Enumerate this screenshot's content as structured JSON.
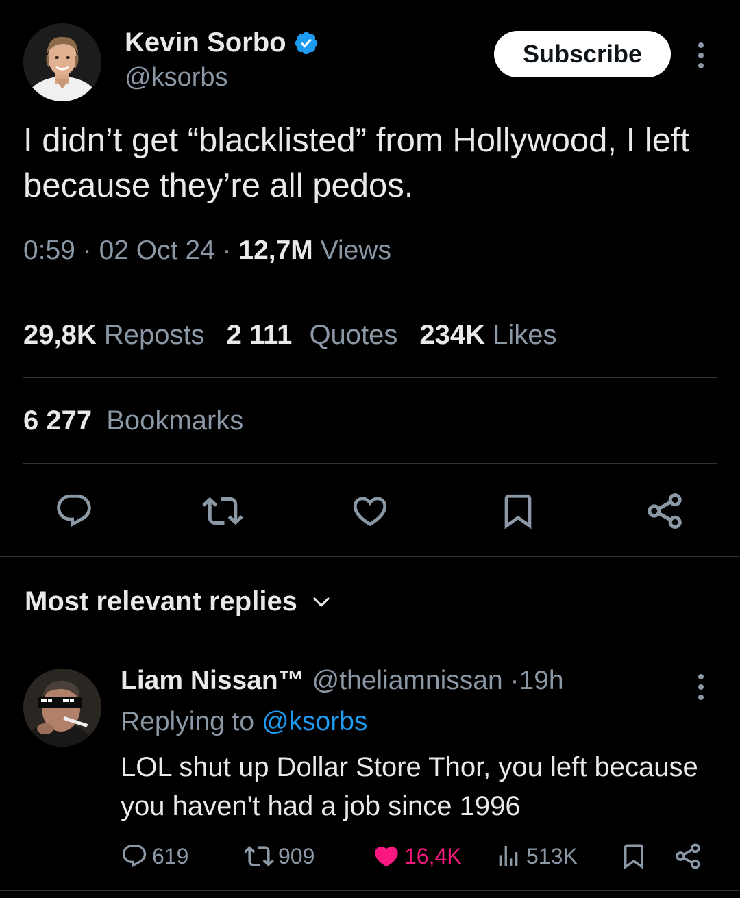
{
  "tweet": {
    "author_name": "Kevin Sorbo",
    "author_handle": "@ksorbs",
    "subscribe_label": "Subscribe",
    "text": "I didn’t get “blacklisted” from Hollywood, I left because they’re all pedos.",
    "time": "0:59",
    "separator": "·",
    "date": "02 Oct 24",
    "views_count": "12,7M",
    "views_label": "Views",
    "reposts_count": "29,8K",
    "reposts_label": "Reposts",
    "quotes_count": "2 111",
    "quotes_label": "Quotes",
    "likes_count": "234K",
    "likes_label": "Likes",
    "bookmarks_count": "6 277",
    "bookmarks_label": "Bookmarks"
  },
  "actions": {
    "icons": [
      "reply-icon",
      "repost-icon",
      "like-icon",
      "bookmark-icon",
      "share-icon"
    ]
  },
  "replies_header": {
    "label": "Most relevant replies"
  },
  "reply": {
    "author_name": "Liam Nissan™",
    "author_handle": "@theliamnissan",
    "separator": "·",
    "time": "19h",
    "replying_prefix": "Replying to",
    "replying_handle": "@ksorbs",
    "text": "LOL shut up Dollar Store Thor, you left because you haven't had a job since 1996",
    "reply_count": "619",
    "repost_count": "909",
    "like_count": "16,4K",
    "view_count": "513K"
  },
  "colors": {
    "background": "#000000",
    "text_primary": "#e7e9ea",
    "text_secondary": "#8b98a5",
    "link": "#1d9bf0",
    "like": "#f91880",
    "divider": "#2f3336",
    "verified": "#1d9bf0"
  }
}
